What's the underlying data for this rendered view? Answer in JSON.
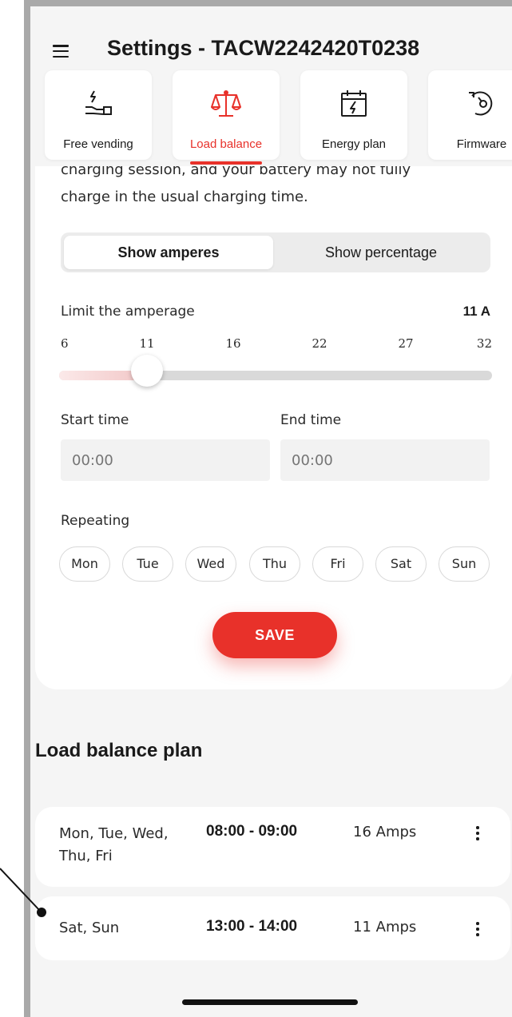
{
  "header": {
    "title": "Settings - TACW2242420T0238"
  },
  "tabs": [
    {
      "label": "Free vending",
      "icon": "hand-lightning-icon"
    },
    {
      "label": "Load balance",
      "icon": "scales-icon"
    },
    {
      "label": "Energy plan",
      "icon": "calendar-lightning-icon"
    },
    {
      "label": "Firmware",
      "icon": "firmware-update-icon"
    }
  ],
  "active_tab": "Load balance",
  "description": {
    "cut_line": "charging session, and your battery may not fully",
    "line": "charge in the usual charging time."
  },
  "segment": {
    "amperes": "Show amperes",
    "percentage": "Show percentage",
    "selected": "Show amperes"
  },
  "limit": {
    "label": "Limit the amperage",
    "value_label": "11 A",
    "value": 11,
    "min": 6,
    "max": 32,
    "ticks": [
      "6",
      "11",
      "16",
      "22",
      "27",
      "32"
    ]
  },
  "times": {
    "start_label": "Start time",
    "end_label": "End time",
    "start_placeholder": "00:00",
    "end_placeholder": "00:00"
  },
  "repeating": {
    "label": "Repeating",
    "days": [
      "Mon",
      "Tue",
      "Wed",
      "Thu",
      "Fri",
      "Sat",
      "Sun"
    ]
  },
  "save_label": "SAVE",
  "plan": {
    "title": "Load balance plan",
    "rows": [
      {
        "days": "Mon, Tue, Wed, Thu, Fri",
        "time": "08:00 - 09:00",
        "amps": "16 Amps"
      },
      {
        "days": "Sat, Sun",
        "time": "13:00 - 14:00",
        "amps": "11 Amps"
      }
    ]
  },
  "colors": {
    "accent": "#e8312a",
    "background": "#f5f5f5",
    "card": "#ffffff"
  }
}
